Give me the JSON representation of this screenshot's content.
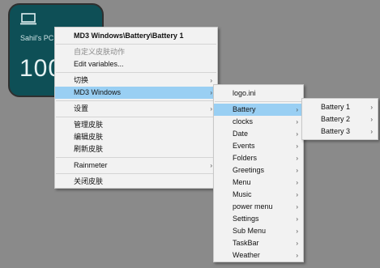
{
  "widget": {
    "icon": "laptop-icon",
    "name": "Sahil's PC",
    "percent": "100"
  },
  "menu1": {
    "title": "MD3 Windows\\Battery\\Battery 1",
    "custom_actions": "自定义皮肤动作",
    "edit_variables": "Edit variables...",
    "switch": "切换",
    "md3_windows": "MD3 Windows",
    "settings": "设置",
    "manage": "管理皮肤",
    "edit": "编辑皮肤",
    "refresh": "刷新皮肤",
    "rainmeter": "Rainmeter",
    "close": "关闭皮肤"
  },
  "menu2": {
    "items": [
      "logo.ini",
      "Battery",
      "clocks",
      "Date",
      "Events",
      "Folders",
      "Greetings",
      "Menu",
      "Music",
      "power menu",
      "Settings",
      "Sub Menu",
      "TaskBar",
      "Weather"
    ]
  },
  "menu3": {
    "items": [
      "Battery 1",
      "Battery 2",
      "Battery 3"
    ]
  },
  "colors": {
    "highlight": "#99cff3",
    "widget_bg": "#0e4f56",
    "desktop": "#8a8a8a"
  },
  "submenu_arrow": "›"
}
